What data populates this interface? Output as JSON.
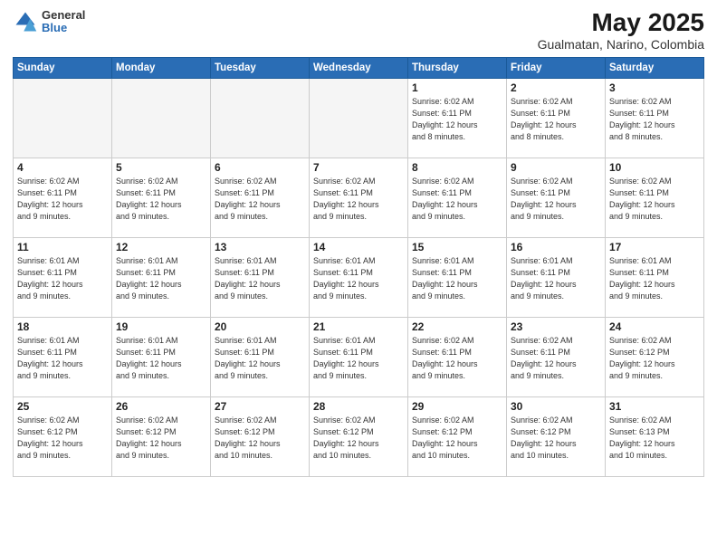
{
  "logo": {
    "general": "General",
    "blue": "Blue"
  },
  "title": "May 2025",
  "subtitle": "Gualmatan, Narino, Colombia",
  "days_header": [
    "Sunday",
    "Monday",
    "Tuesday",
    "Wednesday",
    "Thursday",
    "Friday",
    "Saturday"
  ],
  "weeks": [
    [
      {
        "day": "",
        "info": ""
      },
      {
        "day": "",
        "info": ""
      },
      {
        "day": "",
        "info": ""
      },
      {
        "day": "",
        "info": ""
      },
      {
        "day": "1",
        "info": "Sunrise: 6:02 AM\nSunset: 6:11 PM\nDaylight: 12 hours\nand 8 minutes."
      },
      {
        "day": "2",
        "info": "Sunrise: 6:02 AM\nSunset: 6:11 PM\nDaylight: 12 hours\nand 8 minutes."
      },
      {
        "day": "3",
        "info": "Sunrise: 6:02 AM\nSunset: 6:11 PM\nDaylight: 12 hours\nand 8 minutes."
      }
    ],
    [
      {
        "day": "4",
        "info": "Sunrise: 6:02 AM\nSunset: 6:11 PM\nDaylight: 12 hours\nand 9 minutes."
      },
      {
        "day": "5",
        "info": "Sunrise: 6:02 AM\nSunset: 6:11 PM\nDaylight: 12 hours\nand 9 minutes."
      },
      {
        "day": "6",
        "info": "Sunrise: 6:02 AM\nSunset: 6:11 PM\nDaylight: 12 hours\nand 9 minutes."
      },
      {
        "day": "7",
        "info": "Sunrise: 6:02 AM\nSunset: 6:11 PM\nDaylight: 12 hours\nand 9 minutes."
      },
      {
        "day": "8",
        "info": "Sunrise: 6:02 AM\nSunset: 6:11 PM\nDaylight: 12 hours\nand 9 minutes."
      },
      {
        "day": "9",
        "info": "Sunrise: 6:02 AM\nSunset: 6:11 PM\nDaylight: 12 hours\nand 9 minutes."
      },
      {
        "day": "10",
        "info": "Sunrise: 6:02 AM\nSunset: 6:11 PM\nDaylight: 12 hours\nand 9 minutes."
      }
    ],
    [
      {
        "day": "11",
        "info": "Sunrise: 6:01 AM\nSunset: 6:11 PM\nDaylight: 12 hours\nand 9 minutes."
      },
      {
        "day": "12",
        "info": "Sunrise: 6:01 AM\nSunset: 6:11 PM\nDaylight: 12 hours\nand 9 minutes."
      },
      {
        "day": "13",
        "info": "Sunrise: 6:01 AM\nSunset: 6:11 PM\nDaylight: 12 hours\nand 9 minutes."
      },
      {
        "day": "14",
        "info": "Sunrise: 6:01 AM\nSunset: 6:11 PM\nDaylight: 12 hours\nand 9 minutes."
      },
      {
        "day": "15",
        "info": "Sunrise: 6:01 AM\nSunset: 6:11 PM\nDaylight: 12 hours\nand 9 minutes."
      },
      {
        "day": "16",
        "info": "Sunrise: 6:01 AM\nSunset: 6:11 PM\nDaylight: 12 hours\nand 9 minutes."
      },
      {
        "day": "17",
        "info": "Sunrise: 6:01 AM\nSunset: 6:11 PM\nDaylight: 12 hours\nand 9 minutes."
      }
    ],
    [
      {
        "day": "18",
        "info": "Sunrise: 6:01 AM\nSunset: 6:11 PM\nDaylight: 12 hours\nand 9 minutes."
      },
      {
        "day": "19",
        "info": "Sunrise: 6:01 AM\nSunset: 6:11 PM\nDaylight: 12 hours\nand 9 minutes."
      },
      {
        "day": "20",
        "info": "Sunrise: 6:01 AM\nSunset: 6:11 PM\nDaylight: 12 hours\nand 9 minutes."
      },
      {
        "day": "21",
        "info": "Sunrise: 6:01 AM\nSunset: 6:11 PM\nDaylight: 12 hours\nand 9 minutes."
      },
      {
        "day": "22",
        "info": "Sunrise: 6:02 AM\nSunset: 6:11 PM\nDaylight: 12 hours\nand 9 minutes."
      },
      {
        "day": "23",
        "info": "Sunrise: 6:02 AM\nSunset: 6:11 PM\nDaylight: 12 hours\nand 9 minutes."
      },
      {
        "day": "24",
        "info": "Sunrise: 6:02 AM\nSunset: 6:12 PM\nDaylight: 12 hours\nand 9 minutes."
      }
    ],
    [
      {
        "day": "25",
        "info": "Sunrise: 6:02 AM\nSunset: 6:12 PM\nDaylight: 12 hours\nand 9 minutes."
      },
      {
        "day": "26",
        "info": "Sunrise: 6:02 AM\nSunset: 6:12 PM\nDaylight: 12 hours\nand 9 minutes."
      },
      {
        "day": "27",
        "info": "Sunrise: 6:02 AM\nSunset: 6:12 PM\nDaylight: 12 hours\nand 10 minutes."
      },
      {
        "day": "28",
        "info": "Sunrise: 6:02 AM\nSunset: 6:12 PM\nDaylight: 12 hours\nand 10 minutes."
      },
      {
        "day": "29",
        "info": "Sunrise: 6:02 AM\nSunset: 6:12 PM\nDaylight: 12 hours\nand 10 minutes."
      },
      {
        "day": "30",
        "info": "Sunrise: 6:02 AM\nSunset: 6:12 PM\nDaylight: 12 hours\nand 10 minutes."
      },
      {
        "day": "31",
        "info": "Sunrise: 6:02 AM\nSunset: 6:13 PM\nDaylight: 12 hours\nand 10 minutes."
      }
    ]
  ]
}
